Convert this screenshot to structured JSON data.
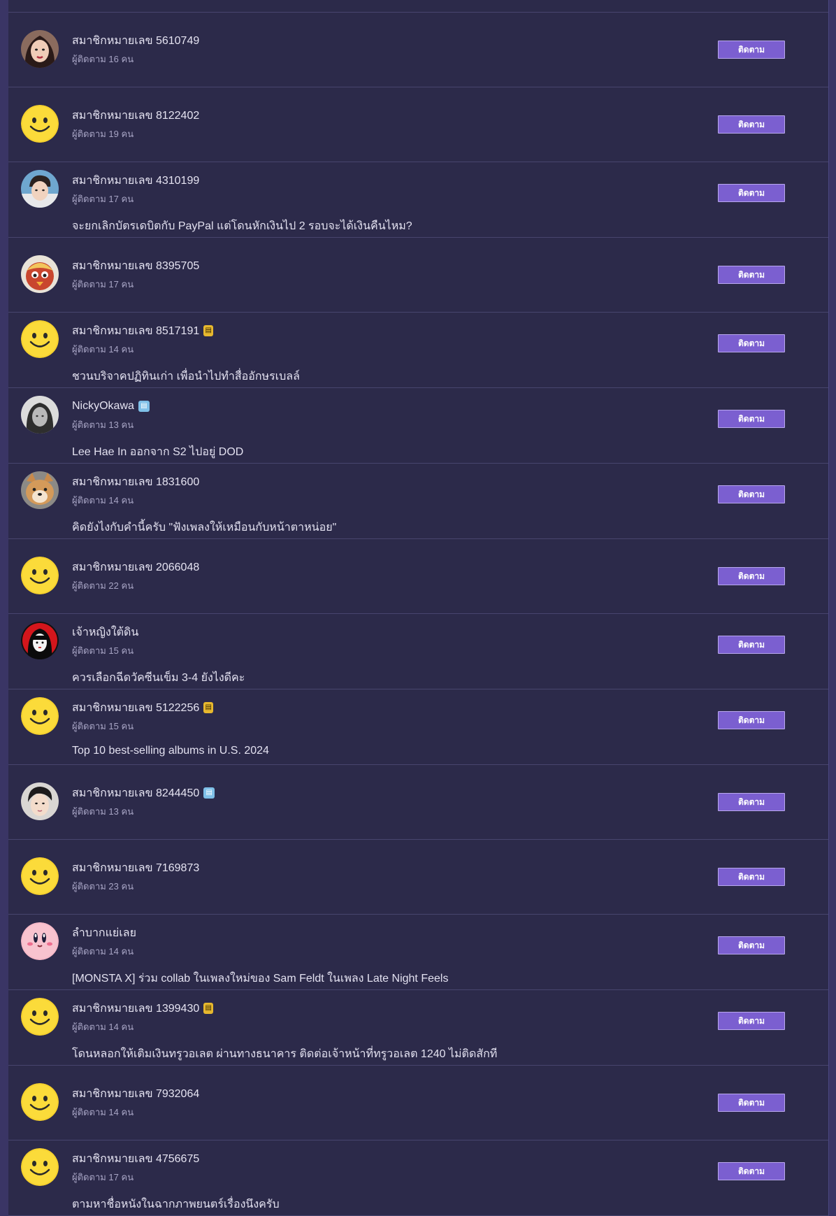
{
  "follow_label": "ติดตาม",
  "users": [
    {
      "name": "สมาชิกหมายเลข 5610749",
      "followers": "ผู้ติดตาม 16 คน",
      "post": "",
      "avatar": "photo-woman",
      "badge": ""
    },
    {
      "name": "สมาชิกหมายเลข 8122402",
      "followers": "ผู้ติดตาม 19 คน",
      "post": "",
      "avatar": "smiley",
      "badge": ""
    },
    {
      "name": "สมาชิกหมายเลข 4310199",
      "followers": "ผู้ติดตาม 17 คน",
      "post": "จะยกเลิกบัตรเดบิตกับ PayPal แต่โดนหักเงินไป 2 รอบจะได้เงินคืนไหม?",
      "avatar": "photo-man",
      "badge": ""
    },
    {
      "name": "สมาชิกหมายเลข 8395705",
      "followers": "ผู้ติดตาม 17 คน",
      "post": "",
      "avatar": "cartoon-bird",
      "badge": ""
    },
    {
      "name": "สมาชิกหมายเลข 8517191",
      "followers": "ผู้ติดตาม 14 คน",
      "post": "ชวนบริจาคปฏิทินเก่า เพื่อนำไปทำสื่ออักษรเบลล์",
      "avatar": "smiley",
      "badge": "phone"
    },
    {
      "name": "NickyOkawa",
      "followers": "ผู้ติดตาม 13 คน",
      "post": "Lee Hae In ออกจาก S2 ไปอยู่ DOD",
      "avatar": "photo-bw",
      "badge": "blog"
    },
    {
      "name": "สมาชิกหมายเลข 1831600",
      "followers": "ผู้ติดตาม 14 คน",
      "post": "คิดยังไงกับคำนี้ครับ \"ฟังเพลงให้เหมือนกับหน้าตาหน่อย\"",
      "avatar": "photo-dog",
      "badge": ""
    },
    {
      "name": "สมาชิกหมายเลข 2066048",
      "followers": "ผู้ติดตาม 22 คน",
      "post": "",
      "avatar": "smiley",
      "badge": ""
    },
    {
      "name": "เจ้าหญิงใต้ดิน",
      "followers": "ผู้ติดตาม 15 คน",
      "post": "ควรเลือกฉีดวัคซีนเข็ม 3-4 ยังไงดีคะ",
      "avatar": "cartoon-girl",
      "badge": ""
    },
    {
      "name": "สมาชิกหมายเลข 5122256",
      "followers": "ผู้ติดตาม 15 คน",
      "post": "Top 10 best-selling albums in U.S. 2024",
      "avatar": "smiley",
      "badge": "phone"
    },
    {
      "name": "สมาชิกหมายเลข 8244450",
      "followers": "ผู้ติดตาม 13 คน",
      "post": "",
      "avatar": "photo-man2",
      "badge": "blog"
    },
    {
      "name": "สมาชิกหมายเลข 7169873",
      "followers": "ผู้ติดตาม 23 คน",
      "post": "",
      "avatar": "smiley",
      "badge": ""
    },
    {
      "name": "ลำบากแย่เลย",
      "followers": "ผู้ติดตาม 14 คน",
      "post": "[MONSTA X] ร่วม collab ในเพลงใหม่ของ Sam Feldt ในเพลง Late Night Feels",
      "avatar": "kirby",
      "badge": ""
    },
    {
      "name": "สมาชิกหมายเลข 1399430",
      "followers": "ผู้ติดตาม 14 คน",
      "post": "โดนหลอกให้เติมเงินทรูวอเลต ผ่านทางธนาคาร ติดต่อเจ้าหน้าที่ทรูวอเลต 1240 ไม่ติดสักที",
      "avatar": "smiley",
      "badge": "phone"
    },
    {
      "name": "สมาชิกหมายเลข 7932064",
      "followers": "ผู้ติดตาม 14 คน",
      "post": "",
      "avatar": "smiley",
      "badge": ""
    },
    {
      "name": "สมาชิกหมายเลข 4756675",
      "followers": "ผู้ติดตาม 17 คน",
      "post": "ตามหาชื่อหนังในฉากภาพยนตร์เรื่องนึงครับ",
      "avatar": "smiley",
      "badge": ""
    }
  ]
}
